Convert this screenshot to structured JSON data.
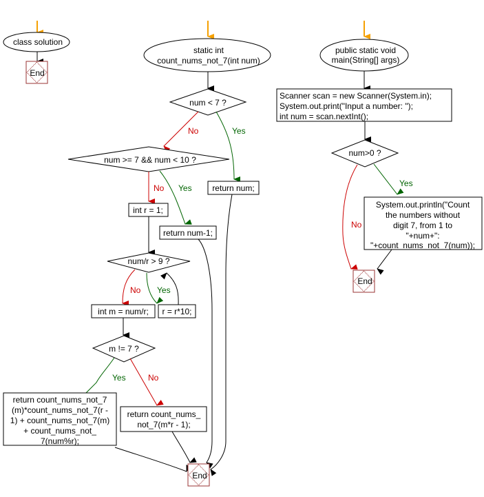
{
  "diagram": {
    "type": "flowchart",
    "colors": {
      "start_arrow": "#f5a000",
      "yes": "#006400",
      "no": "#cc0000",
      "end_border": "#993333",
      "flow": "#000000"
    },
    "edge_labels": {
      "yes": "Yes",
      "no": "No"
    },
    "class_flow": {
      "start": "class solution",
      "end": "End"
    },
    "count_func": {
      "start_line1": "static int",
      "start_line2": "count_nums_not_7(int num)",
      "cond1": "num < 7 ?",
      "ret_num": "return num;",
      "cond2": "num >= 7 && num < 10 ?",
      "ret_num_minus1": "return num-1;",
      "init_r": "int r = 1;",
      "cond3": "num/r > 9 ?",
      "m_assign": "int m = num/r;",
      "r_update": "r = r*10;",
      "cond4": "m != 7 ?",
      "ret_yes_lines": [
        "return count_nums_not_7",
        "(m)*count_nums_not_7(r -",
        "1) + count_nums_not_7(m)",
        "+ count_nums_not_",
        "7(num%r);"
      ],
      "ret_no_lines": [
        "return count_nums_",
        "not_7(m*r - 1);"
      ],
      "end": "End"
    },
    "main_func": {
      "start_line1": "public static void",
      "start_line2": "main(String[] args)",
      "stmt_lines": [
        "Scanner scan = new Scanner(System.in);",
        "System.out.print(\"Input a number: \");",
        "int num = scan.nextInt();"
      ],
      "cond": "num>0 ?",
      "print_lines": [
        "System.out.println(\"Count",
        "the numbers without",
        "digit 7, from 1 to",
        "\"+num+\":",
        "\"+count_nums_not_7(num));"
      ],
      "end": "End"
    }
  }
}
